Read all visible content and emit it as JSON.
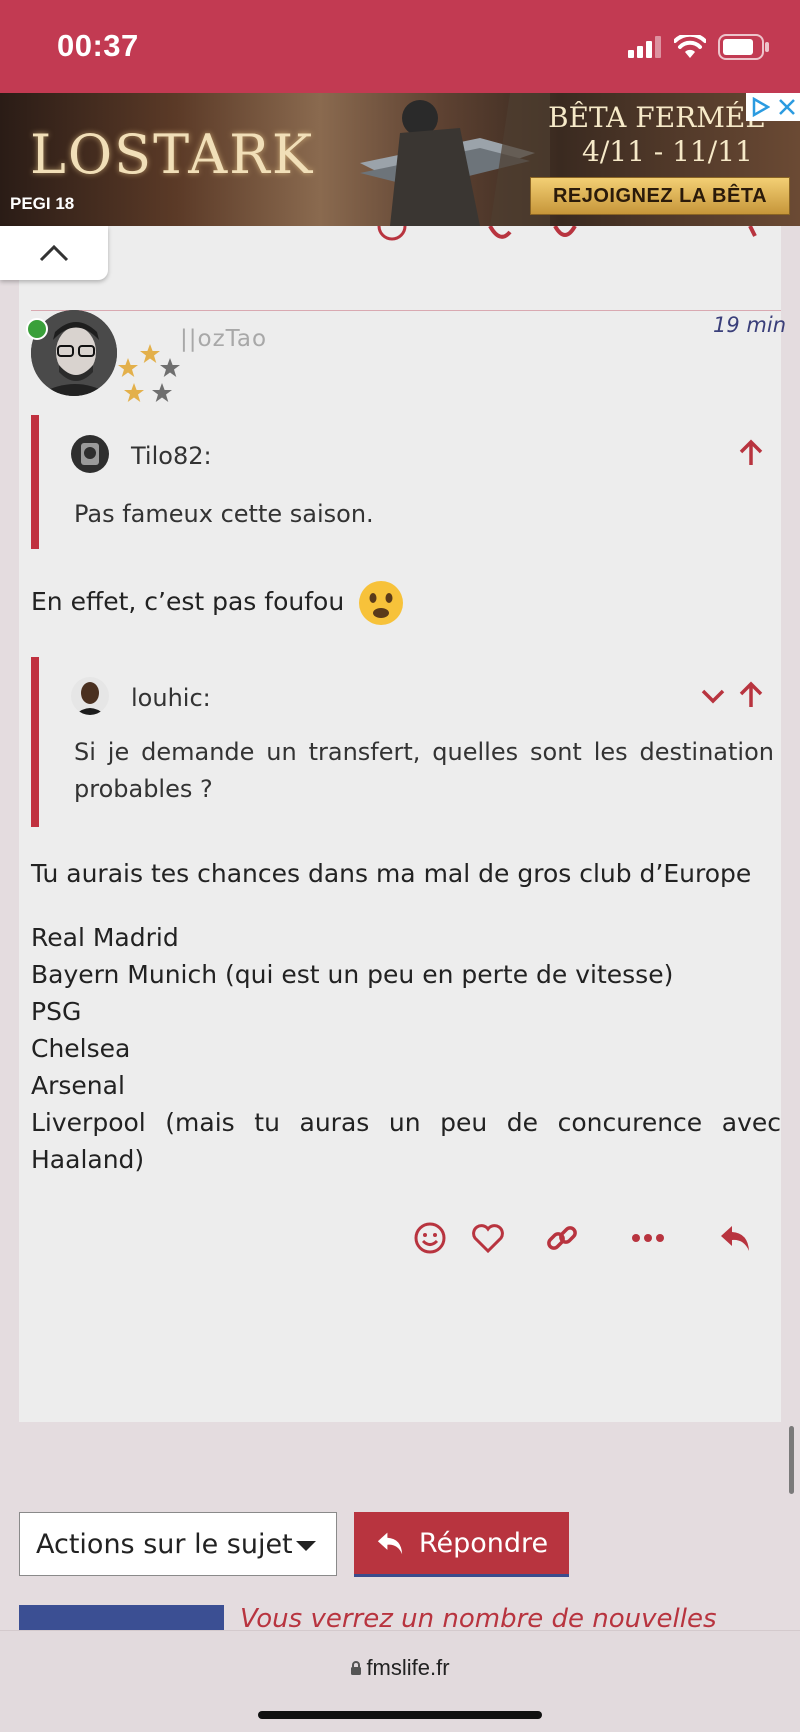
{
  "status_bar": {
    "time": "00:37",
    "battery": "battery-icon",
    "wifi": "wifi-icon",
    "signal": "signal-icon"
  },
  "ad": {
    "logo": "LOSTARK",
    "rating": "PEGI 18",
    "title": "BÊTA FERMÉE",
    "dates": "4/11 - 11/11",
    "cta": "REJOIGNEZ LA BÊTA"
  },
  "post": {
    "username": "||ozTao",
    "time": "19 min",
    "quote1": {
      "author": "Tilo82:",
      "text": "Pas fameux cette saison."
    },
    "reply1": "En effet, c’est pas foufou",
    "quote2": {
      "author": "louhic:",
      "text": "Si je demande un transfert, quelles sont les destination probables ?"
    },
    "reply2": "Tu aurais tes chances dans ma mal de gros club d’Europe",
    "clubs": [
      "Real Madrid",
      "Bayern Munich (qui est un peu en perte de vitesse)",
      "PSG",
      "Chelsea",
      "Arsenal",
      "Liverpool (mais tu auras un peu de concurence avec Haaland)"
    ],
    "actions": [
      "smiley-icon",
      "heart-icon",
      "link-icon",
      "more-icon",
      "reply-icon"
    ]
  },
  "controls": {
    "topic_actions": "Actions sur le sujet",
    "reply": "Répondre",
    "notify_text": "Vous verrez un nombre de nouvelles"
  },
  "browser": {
    "url": "fmslife.fr"
  },
  "colors": {
    "brand": "#c23a52",
    "accent": "#b8343f",
    "secondary": "#3b4f93"
  }
}
